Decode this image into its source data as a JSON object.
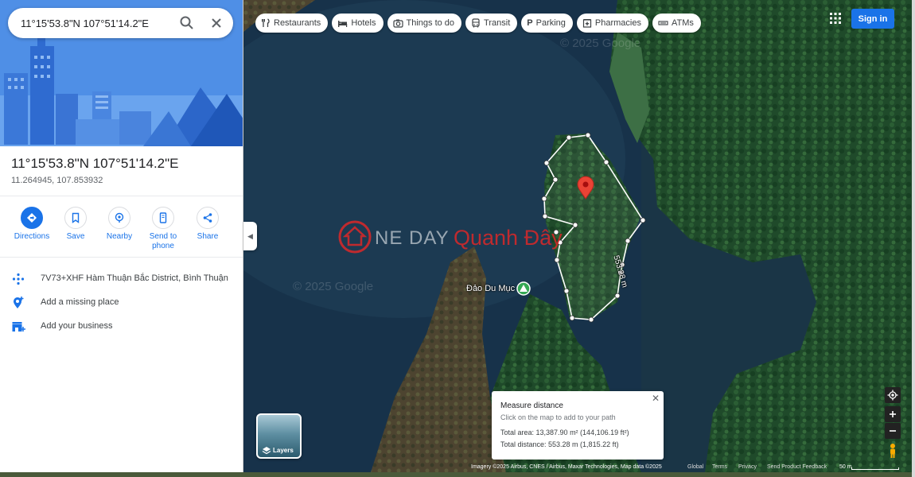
{
  "search": {
    "value": "11°15'53.8\"N 107°51'14.2\"E",
    "search_icon": "search-icon",
    "close_icon": "close-icon"
  },
  "place": {
    "title": "11°15'53.8\"N 107°51'14.2\"E",
    "decimal_coords": "11.264945, 107.853932"
  },
  "actions": [
    {
      "label": "Directions",
      "icon": "directions-icon"
    },
    {
      "label": "Save",
      "icon": "bookmark-icon"
    },
    {
      "label": "Nearby",
      "icon": "nearby-icon"
    },
    {
      "label": "Send to phone",
      "icon": "phone-icon"
    },
    {
      "label": "Share",
      "icon": "share-icon"
    }
  ],
  "info": {
    "plus_code": "7V73+XHF Hàm Thuận Bắc District, Bình Thuận",
    "add_missing_place": "Add a missing place",
    "add_business": "Add your business"
  },
  "chips": [
    {
      "label": "Restaurants",
      "icon": "fork-knife-icon"
    },
    {
      "label": "Hotels",
      "icon": "bed-icon"
    },
    {
      "label": "Things to do",
      "icon": "camera-icon"
    },
    {
      "label": "Transit",
      "icon": "bus-icon"
    },
    {
      "label": "Parking",
      "icon": "parking-icon"
    },
    {
      "label": "Pharmacies",
      "icon": "pharmacy-icon"
    },
    {
      "label": "ATMs",
      "icon": "atm-icon"
    }
  ],
  "header": {
    "sign_in": "Sign in"
  },
  "map": {
    "place_label": "Đảo Du Mục",
    "distance_label": "553.28 m",
    "watermark_a": "NE DAY",
    "watermark_b": "Quanh Đây",
    "google_watermark": "© 2025 Google",
    "layers_label": "Layers"
  },
  "measure": {
    "title": "Measure distance",
    "hint": "Click on the map to add to your path",
    "total_area": "Total area: 13,387.90 m² (144,106.19 ft²)",
    "total_distance": "Total distance: 553.28 m (1,815.22 ft)"
  },
  "footer": {
    "imagery": "Imagery ©2025 Airbus, CNES / Airbus, Maxar Technologies, Map data ©2025",
    "links": [
      "Global",
      "Terms",
      "Privacy",
      "Send Product Feedback"
    ],
    "scale": "50 m"
  },
  "colors": {
    "accent": "#1a73e8",
    "pin": "#ea4335"
  }
}
